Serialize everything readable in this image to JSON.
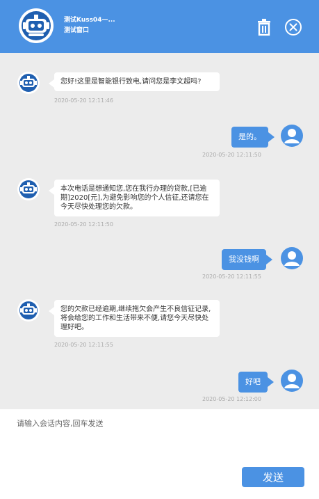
{
  "header": {
    "title": "测试Kuss04—...",
    "subtitle": "测试窗口",
    "trash_icon": "trash-icon",
    "close_icon": "close-circle-icon"
  },
  "messages": [
    {
      "from": "bot",
      "text": "您好!这里是智能银行致电,请问您是李文超吗?",
      "time": "2020-05-20 12:11:46"
    },
    {
      "from": "user",
      "text": "是的。",
      "time": "2020-05-20 12:11:50"
    },
    {
      "from": "bot",
      "text": "本次电话是想通知您,您在我行办理的贷款,[已逾期]2020[元],为避免影响您的个人信征,还请您在今天尽快处理您的欠款。",
      "time": "2020-05-20 12:11:50"
    },
    {
      "from": "user",
      "text": "我没钱啊",
      "time": "2020-05-20 12:11:55"
    },
    {
      "from": "bot",
      "text": "您的欠款已经逾期,继续拖欠会产生不良信征记录,将会给您的工作和生活带来不便,请您今天尽快处理好吧。",
      "time": "2020-05-20 12:11:55"
    },
    {
      "from": "user",
      "text": "好吧",
      "time": "2020-05-20 12:12:00"
    }
  ],
  "input": {
    "placeholder": "请输入会话内容,回车发送",
    "value": ""
  },
  "send_label": "发送",
  "colors": {
    "primary": "#4b92e3",
    "chat_bg": "#ececec",
    "bot_bubble": "#ffffff",
    "timestamp": "#aaaaaa"
  }
}
